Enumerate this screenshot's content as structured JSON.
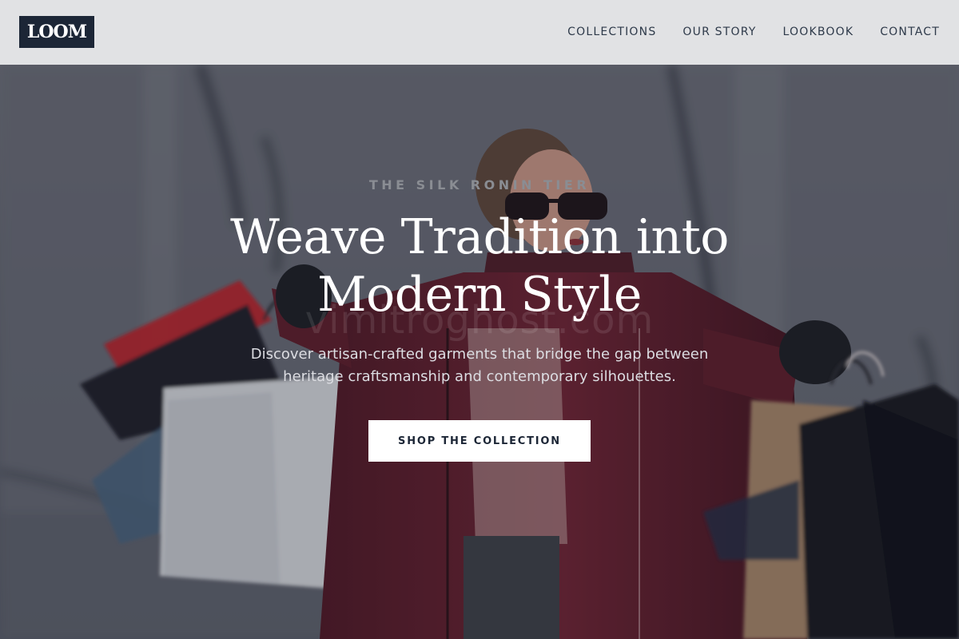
{
  "brand": {
    "logo_text": "LOOM",
    "logo_bg": "#1c2636"
  },
  "nav": {
    "items": [
      {
        "label": "COLLECTIONS"
      },
      {
        "label": "OUR STORY"
      },
      {
        "label": "LOOKBOOK"
      },
      {
        "label": "CONTACT"
      }
    ]
  },
  "hero": {
    "eyebrow": "THE SILK RONIN TIER",
    "headline_line1": "Weave Tradition into",
    "headline_line2": "Modern Style",
    "subtext_line1": "Discover artisan-crafted garments that bridge the gap between",
    "subtext_line2": "heritage craftsmanship and contemporary silhouettes.",
    "cta_label": "SHOP THE COLLECTION",
    "watermark": "vimitroghost.com",
    "image_subject": "woman-with-shopping-bags"
  },
  "colors": {
    "header_bg": "#e1e2e4",
    "nav_text": "#2e3a4a",
    "cta_bg": "#ffffff",
    "cta_text": "#1c2636",
    "coat": "#6b1e2c",
    "red_bag": "#c4141c"
  }
}
